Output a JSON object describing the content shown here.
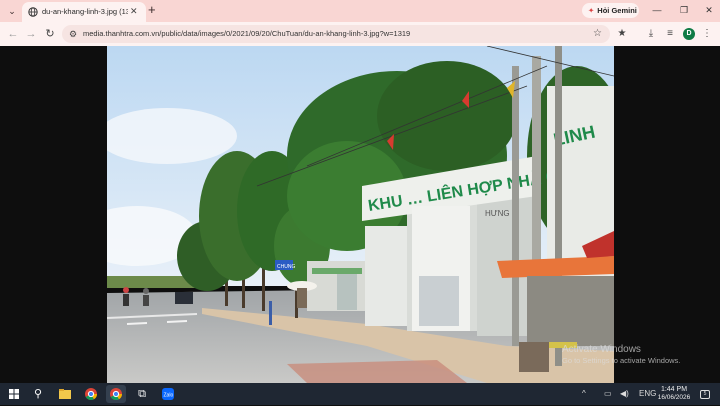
{
  "browser": {
    "tab": {
      "title": "du-an-khang-linh-3.jpg (1319×..."
    },
    "new_tab_symbol": "+",
    "gemini_label": "Hỏi Gemini",
    "url": "media.thanhtra.com.vn/public/data/images/0/2021/09/20/ChuTuan/du-an-khang-linh-3.jpg?w=1319",
    "profile_initial": "D"
  },
  "photo_scene": {
    "banner_text": "KHU … LIÊN HỢP NHÀ Ở",
    "banner_right_text": "LINH",
    "building_sign": "HƯNG",
    "street_sign": "CHUNG"
  },
  "watermark": {
    "title": "Activate Windows",
    "subtitle": "Go to Settings to activate Windows."
  },
  "taskbar": {
    "language": "ENG",
    "time": "1:44 PM",
    "date": "16/06/2026",
    "notification_count": "5"
  },
  "colors": {
    "tabstrip_bg": "#f9d6d3",
    "toolbar_bg": "#fdf2f1",
    "taskbar_bg": "#1f2733",
    "banner_green": "#1f8a4a"
  }
}
